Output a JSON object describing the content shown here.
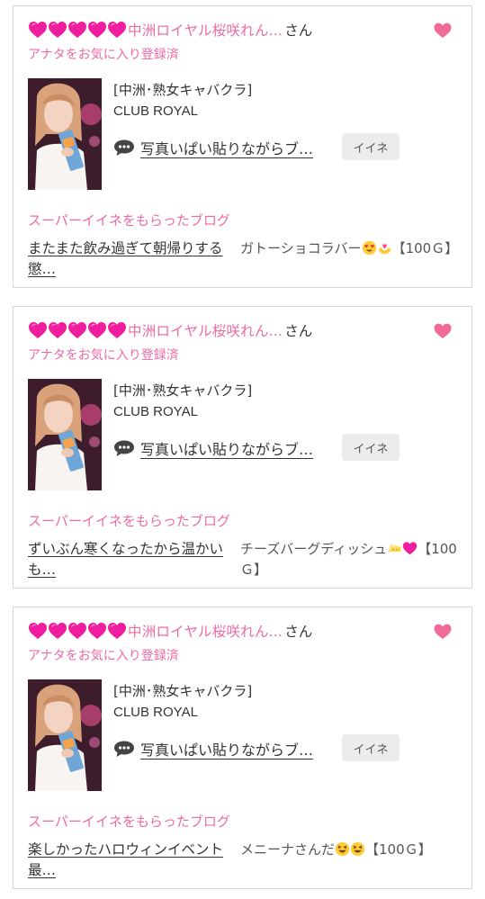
{
  "colors": {
    "accent_pink": "#ec6aa6",
    "heart_magenta": "#f01d9e",
    "fav_heart": "#f06a9a",
    "border": "#d6d6d6",
    "like_bg": "#ececec"
  },
  "cards": [
    {
      "hearts_count": 5,
      "user_name": "中洲ロイヤル桜咲れん…",
      "honorific": "さん",
      "favorite_status": "アナタをお気に入り登録済",
      "category": "[中洲･熟女キャバクラ]",
      "shop_name": "CLUB ROYAL",
      "blog_title": "写真いぱい貼りながらブ…",
      "like_label": "イイネ",
      "super_like_label": "スーパーイイネをもらったブログ",
      "super_blog_title": "またまた飲み過ぎて朝帰りする懲…",
      "gift_text": "ガトーショコラバー",
      "gift_emojis": [
        "heart-eyes-icon",
        "hands-heart-icon"
      ],
      "gift_points": "【100Ｇ】"
    },
    {
      "hearts_count": 5,
      "user_name": "中洲ロイヤル桜咲れん…",
      "honorific": "さん",
      "favorite_status": "アナタをお気に入り登録済",
      "category": "[中洲･熟女キャバクラ]",
      "shop_name": "CLUB ROYAL",
      "blog_title": "写真いぱい貼りながらブ…",
      "like_label": "イイネ",
      "super_like_label": "スーパーイイネをもらったブログ",
      "super_blog_title": "ずいぶん寒くなったから温かいも…",
      "gift_text": "チーズバーグディッシュ",
      "gift_emojis": [
        "cheese-icon",
        "purple-heart-icon"
      ],
      "gift_points": "【100Ｇ】"
    },
    {
      "hearts_count": 5,
      "user_name": "中洲ロイヤル桜咲れん…",
      "honorific": "さん",
      "favorite_status": "アナタをお気に入り登録済",
      "category": "[中洲･熟女キャバクラ]",
      "shop_name": "CLUB ROYAL",
      "blog_title": "写真いぱい貼りながらブ…",
      "like_label": "イイネ",
      "super_like_label": "スーパーイイネをもらったブログ",
      "super_blog_title": "楽しかったハロウィンイベント最…",
      "gift_text": "メニーナさんだ",
      "gift_emojis": [
        "laughing-face-icon",
        "laughing-face-icon"
      ],
      "gift_points": "【100Ｇ】"
    }
  ]
}
